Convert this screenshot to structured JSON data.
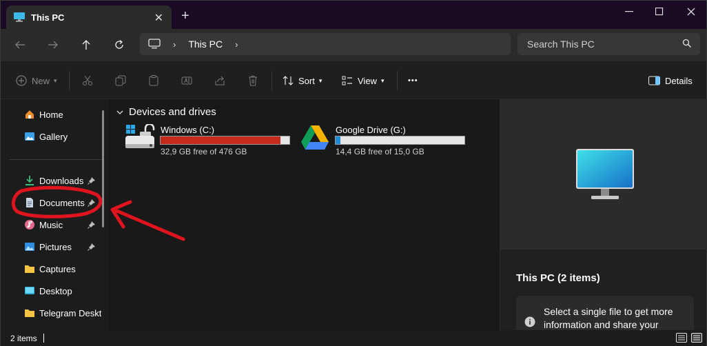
{
  "tab": {
    "title": "This PC",
    "close": "✕"
  },
  "window_controls": {
    "new_tab": "+",
    "minimize": "—",
    "maximize": "☐",
    "close": "✕"
  },
  "address": {
    "location": "This PC"
  },
  "search": {
    "placeholder": "Search This PC"
  },
  "toolbar": {
    "new_label": "New",
    "sort_label": "Sort",
    "view_label": "View",
    "more_label": "•••",
    "details_label": "Details"
  },
  "sidebar": {
    "items": [
      {
        "label": "Home",
        "icon": "home-icon"
      },
      {
        "label": "Gallery",
        "icon": "gallery-icon"
      },
      {
        "label": "Downloads",
        "icon": "downloads-icon",
        "pinned": true
      },
      {
        "label": "Documents",
        "icon": "documents-icon",
        "pinned": true
      },
      {
        "label": "Music",
        "icon": "music-icon",
        "pinned": true
      },
      {
        "label": "Pictures",
        "icon": "pictures-icon",
        "pinned": true
      },
      {
        "label": "Captures",
        "icon": "folder-icon"
      },
      {
        "label": "Desktop",
        "icon": "desktop-icon"
      },
      {
        "label": "Telegram Desktop",
        "icon": "folder-icon"
      }
    ]
  },
  "main": {
    "group_title": "Devices and drives",
    "drives": [
      {
        "name": "Windows (C:)",
        "free": "32,9 GB free of 476 GB",
        "used_fraction": 0.93,
        "bar_color": "#c42b1c"
      },
      {
        "name": "Google Drive (G:)",
        "free": "14,4 GB free of 15,0 GB",
        "used_fraction": 0.04,
        "bar_color": "#1f8dd6"
      }
    ]
  },
  "details": {
    "title": "This PC (2 items)",
    "info": "Select a single file to get more information and share your"
  },
  "status": {
    "count": "2 items"
  },
  "colors": {
    "accent": "#1f8dd6",
    "annotation": "#e0141e",
    "drive_full": "#c42b1c"
  }
}
